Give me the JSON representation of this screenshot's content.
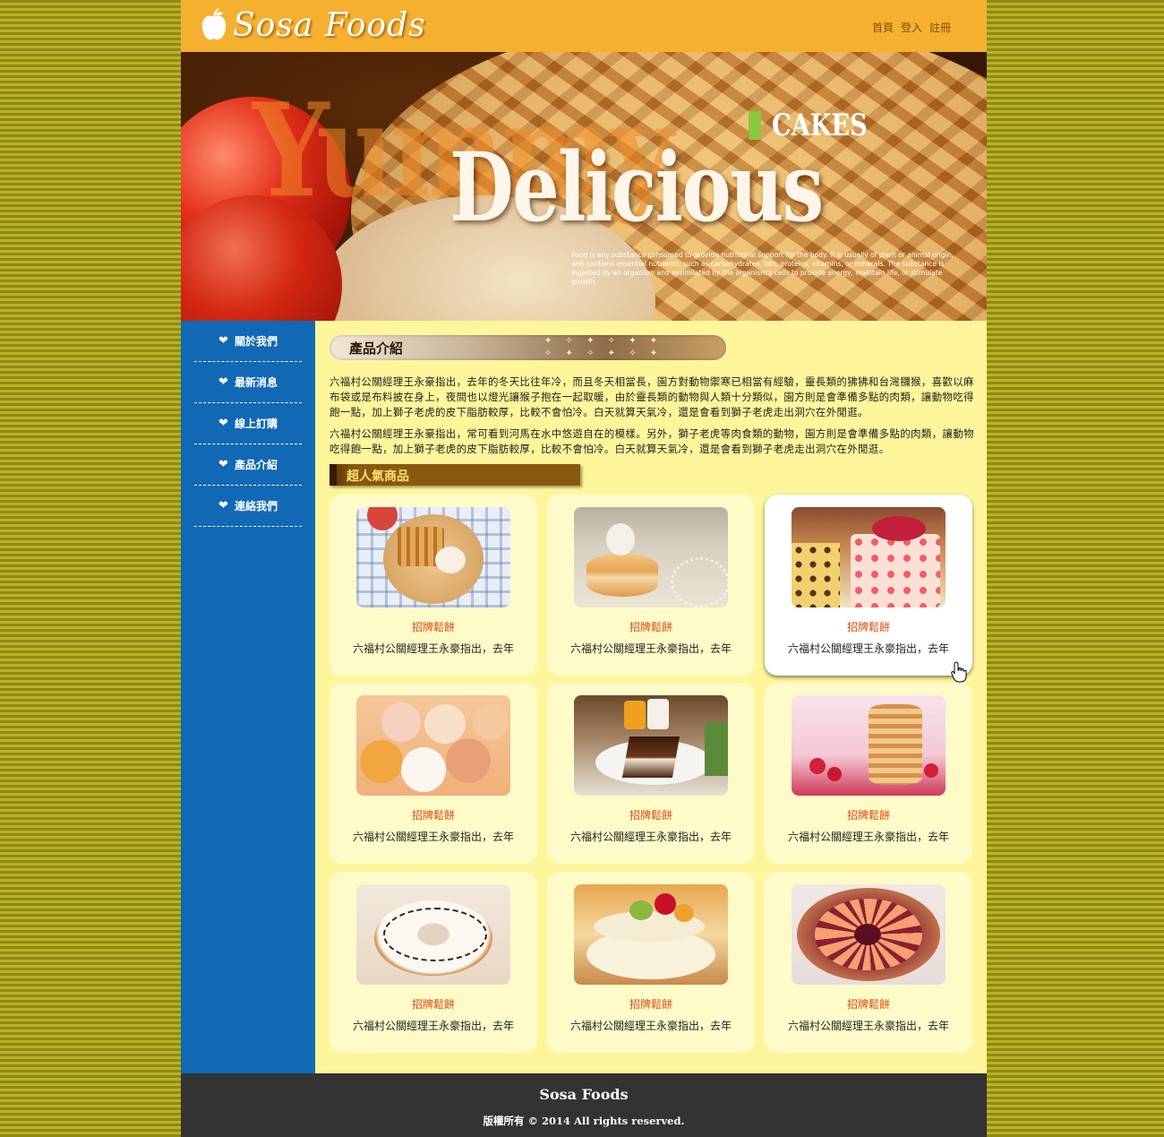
{
  "header": {
    "logo_text": "Sosa Foods",
    "nav": [
      "首頁",
      "登入",
      "註冊"
    ]
  },
  "banner": {
    "overlay_text": "Yummy",
    "tag": "CAKES",
    "headline": "Delicious",
    "small_text": "Food is any substance consumed to provide nutritional support for the body. It is usually of plant or animal origin, and contains essential nutrients, such as carbohydrates, fats, proteins, vitamins, or minerals. The substance is ingested by an organism and assimilated by the organism's cells to provide energy, maintain life, or stimulate growth."
  },
  "sidebar": {
    "items": [
      {
        "label": "關於我們",
        "icon": "heart-icon"
      },
      {
        "label": "最新消息",
        "icon": "heart-icon"
      },
      {
        "label": "線上訂購",
        "icon": "heart-icon"
      },
      {
        "label": "產品介紹",
        "icon": "heart-icon"
      },
      {
        "label": "連絡我們",
        "icon": "heart-icon"
      }
    ]
  },
  "main": {
    "section_title": "產品介紹",
    "paragraphs": [
      "六福村公關經理王永豪指出，去年的冬天比往年冷，而且冬天相當長，園方對動物禦寒已相當有經驗，靈長類的狒狒和台灣獼猴，喜歡以麻布袋或是布料披在身上，夜間也以燈光讓猴子抱在一起取暖，由於靈長類的動物與人類十分類似，園方則是會準備多點的肉類，讓動物吃得飽一點，加上獅子老虎的皮下脂肪較厚，比較不會怕冷。白天就算天氣冷，還是會看到獅子老虎走出洞穴在外閒逛。",
      "六福村公關經理王永豪指出，常可看到河馬在水中悠遊自在的模樣。另外，獅子老虎等肉食類的動物，園方則是會準備多點的肉類，讓動物吃得飽一點，加上獅子老虎的皮下脂肪較厚，比較不會怕冷。白天就算天氣冷，還是會看到獅子老虎走出洞穴在外閒逛。"
    ],
    "popular_title": "超人氣商品",
    "products": [
      {
        "name": "招牌鬆餅",
        "desc": "六福村公關經理王永豪指出，去年",
        "image": "waffle-photo"
      },
      {
        "name": "招牌鬆餅",
        "desc": "六福村公關經理王永豪指出，去年",
        "image": "pancake-cat-photo"
      },
      {
        "name": "招牌鬆餅",
        "desc": "六福村公關經理王永豪指出，去年",
        "image": "mousse-cake-photo"
      },
      {
        "name": "招牌鬆餅",
        "desc": "六福村公關經理王永豪指出，去年",
        "image": "animal-buns-photo"
      },
      {
        "name": "招牌鬆餅",
        "desc": "六福村公關經理王永豪指出，去年",
        "image": "chocolate-cake-photo"
      },
      {
        "name": "招牌鬆餅",
        "desc": "六福村公關經理王永豪指出，去年",
        "image": "pancake-stack-photo"
      },
      {
        "name": "招牌鬆餅",
        "desc": "六福村公關經理王永豪指出，去年",
        "image": "donut-photo"
      },
      {
        "name": "招牌鬆餅",
        "desc": "六福村公關經理王永豪指出，去年",
        "image": "fruit-cake-photo"
      },
      {
        "name": "招牌鬆餅",
        "desc": "六福村公關經理王永豪指出，去年",
        "image": "peach-tart-photo"
      }
    ]
  },
  "footer": {
    "brand": "Sosa Foods",
    "copyright": "版權所有 © 2014 All rights reserved."
  },
  "colors": {
    "header": "#f6b02f",
    "sidebar": "#1168b4",
    "main_bg": "#fff69b",
    "card_bg": "#fffbc9",
    "product_name": "#e34a0e",
    "footer": "#333333"
  }
}
